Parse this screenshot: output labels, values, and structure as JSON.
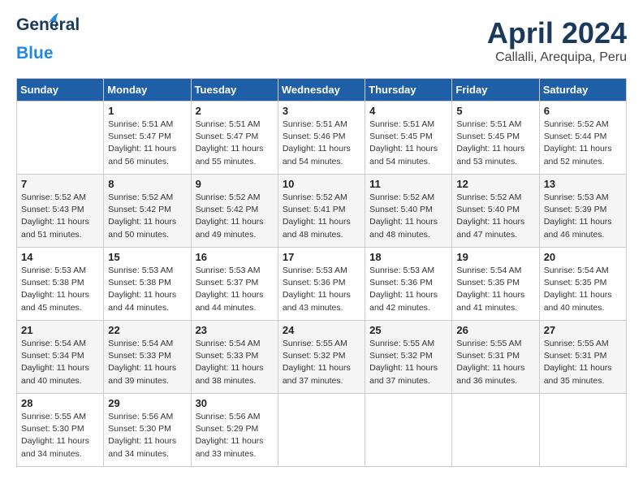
{
  "header": {
    "logo_line1": "General",
    "logo_line2": "Blue",
    "month_title": "April 2024",
    "location": "Callalli, Arequipa, Peru"
  },
  "weekdays": [
    "Sunday",
    "Monday",
    "Tuesday",
    "Wednesday",
    "Thursday",
    "Friday",
    "Saturday"
  ],
  "weeks": [
    [
      {
        "day": "",
        "info": ""
      },
      {
        "day": "1",
        "info": "Sunrise: 5:51 AM\nSunset: 5:47 PM\nDaylight: 11 hours\nand 56 minutes."
      },
      {
        "day": "2",
        "info": "Sunrise: 5:51 AM\nSunset: 5:47 PM\nDaylight: 11 hours\nand 55 minutes."
      },
      {
        "day": "3",
        "info": "Sunrise: 5:51 AM\nSunset: 5:46 PM\nDaylight: 11 hours\nand 54 minutes."
      },
      {
        "day": "4",
        "info": "Sunrise: 5:51 AM\nSunset: 5:45 PM\nDaylight: 11 hours\nand 54 minutes."
      },
      {
        "day": "5",
        "info": "Sunrise: 5:51 AM\nSunset: 5:45 PM\nDaylight: 11 hours\nand 53 minutes."
      },
      {
        "day": "6",
        "info": "Sunrise: 5:52 AM\nSunset: 5:44 PM\nDaylight: 11 hours\nand 52 minutes."
      }
    ],
    [
      {
        "day": "7",
        "info": "Sunrise: 5:52 AM\nSunset: 5:43 PM\nDaylight: 11 hours\nand 51 minutes."
      },
      {
        "day": "8",
        "info": "Sunrise: 5:52 AM\nSunset: 5:42 PM\nDaylight: 11 hours\nand 50 minutes."
      },
      {
        "day": "9",
        "info": "Sunrise: 5:52 AM\nSunset: 5:42 PM\nDaylight: 11 hours\nand 49 minutes."
      },
      {
        "day": "10",
        "info": "Sunrise: 5:52 AM\nSunset: 5:41 PM\nDaylight: 11 hours\nand 48 minutes."
      },
      {
        "day": "11",
        "info": "Sunrise: 5:52 AM\nSunset: 5:40 PM\nDaylight: 11 hours\nand 48 minutes."
      },
      {
        "day": "12",
        "info": "Sunrise: 5:52 AM\nSunset: 5:40 PM\nDaylight: 11 hours\nand 47 minutes."
      },
      {
        "day": "13",
        "info": "Sunrise: 5:53 AM\nSunset: 5:39 PM\nDaylight: 11 hours\nand 46 minutes."
      }
    ],
    [
      {
        "day": "14",
        "info": "Sunrise: 5:53 AM\nSunset: 5:38 PM\nDaylight: 11 hours\nand 45 minutes."
      },
      {
        "day": "15",
        "info": "Sunrise: 5:53 AM\nSunset: 5:38 PM\nDaylight: 11 hours\nand 44 minutes."
      },
      {
        "day": "16",
        "info": "Sunrise: 5:53 AM\nSunset: 5:37 PM\nDaylight: 11 hours\nand 44 minutes."
      },
      {
        "day": "17",
        "info": "Sunrise: 5:53 AM\nSunset: 5:36 PM\nDaylight: 11 hours\nand 43 minutes."
      },
      {
        "day": "18",
        "info": "Sunrise: 5:53 AM\nSunset: 5:36 PM\nDaylight: 11 hours\nand 42 minutes."
      },
      {
        "day": "19",
        "info": "Sunrise: 5:54 AM\nSunset: 5:35 PM\nDaylight: 11 hours\nand 41 minutes."
      },
      {
        "day": "20",
        "info": "Sunrise: 5:54 AM\nSunset: 5:35 PM\nDaylight: 11 hours\nand 40 minutes."
      }
    ],
    [
      {
        "day": "21",
        "info": "Sunrise: 5:54 AM\nSunset: 5:34 PM\nDaylight: 11 hours\nand 40 minutes."
      },
      {
        "day": "22",
        "info": "Sunrise: 5:54 AM\nSunset: 5:33 PM\nDaylight: 11 hours\nand 39 minutes."
      },
      {
        "day": "23",
        "info": "Sunrise: 5:54 AM\nSunset: 5:33 PM\nDaylight: 11 hours\nand 38 minutes."
      },
      {
        "day": "24",
        "info": "Sunrise: 5:55 AM\nSunset: 5:32 PM\nDaylight: 11 hours\nand 37 minutes."
      },
      {
        "day": "25",
        "info": "Sunrise: 5:55 AM\nSunset: 5:32 PM\nDaylight: 11 hours\nand 37 minutes."
      },
      {
        "day": "26",
        "info": "Sunrise: 5:55 AM\nSunset: 5:31 PM\nDaylight: 11 hours\nand 36 minutes."
      },
      {
        "day": "27",
        "info": "Sunrise: 5:55 AM\nSunset: 5:31 PM\nDaylight: 11 hours\nand 35 minutes."
      }
    ],
    [
      {
        "day": "28",
        "info": "Sunrise: 5:55 AM\nSunset: 5:30 PM\nDaylight: 11 hours\nand 34 minutes."
      },
      {
        "day": "29",
        "info": "Sunrise: 5:56 AM\nSunset: 5:30 PM\nDaylight: 11 hours\nand 34 minutes."
      },
      {
        "day": "30",
        "info": "Sunrise: 5:56 AM\nSunset: 5:29 PM\nDaylight: 11 hours\nand 33 minutes."
      },
      {
        "day": "",
        "info": ""
      },
      {
        "day": "",
        "info": ""
      },
      {
        "day": "",
        "info": ""
      },
      {
        "day": "",
        "info": ""
      }
    ]
  ]
}
